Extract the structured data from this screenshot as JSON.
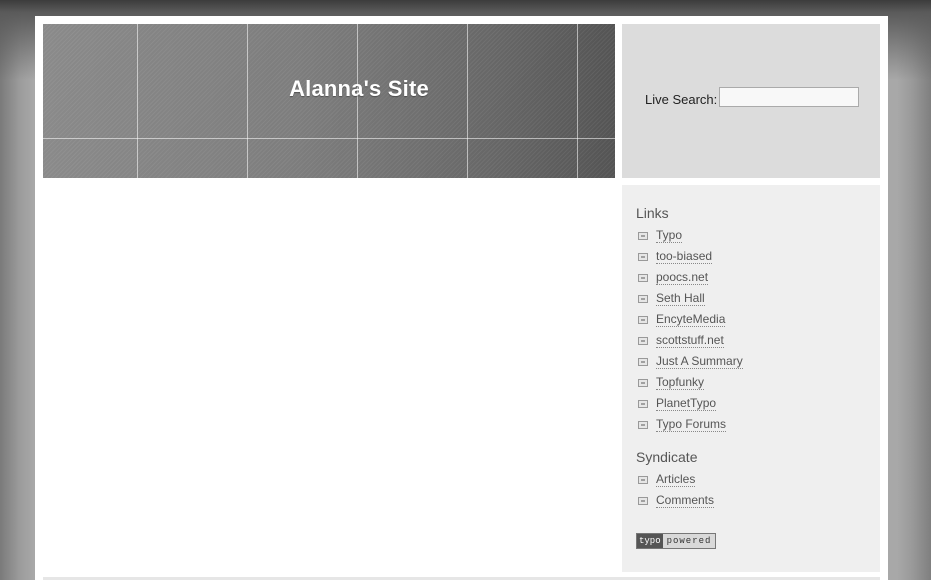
{
  "header": {
    "site_title": "Alanna's Site"
  },
  "search": {
    "label": "Live Search:",
    "value": "",
    "placeholder": ""
  },
  "sidebar": {
    "links_heading": "Links",
    "links": [
      {
        "label": "Typo"
      },
      {
        "label": "too-biased"
      },
      {
        "label": "poocs.net"
      },
      {
        "label": "Seth Hall"
      },
      {
        "label": "EncyteMedia"
      },
      {
        "label": "scottstuff.net"
      },
      {
        "label": "Just A Summary"
      },
      {
        "label": "Topfunky"
      },
      {
        "label": "PlanetTypo"
      },
      {
        "label": "Typo Forums"
      }
    ],
    "syndicate_heading": "Syndicate",
    "syndicate": [
      {
        "label": "Articles"
      },
      {
        "label": "Comments"
      }
    ],
    "badge": {
      "left": "typo",
      "right": "powered"
    }
  },
  "colors": {
    "sidebar_bg": "#efefef",
    "search_bg": "#dcdcdc",
    "link_text": "#555555"
  },
  "icons": {
    "link_bullet": "list-bullet-icon"
  }
}
